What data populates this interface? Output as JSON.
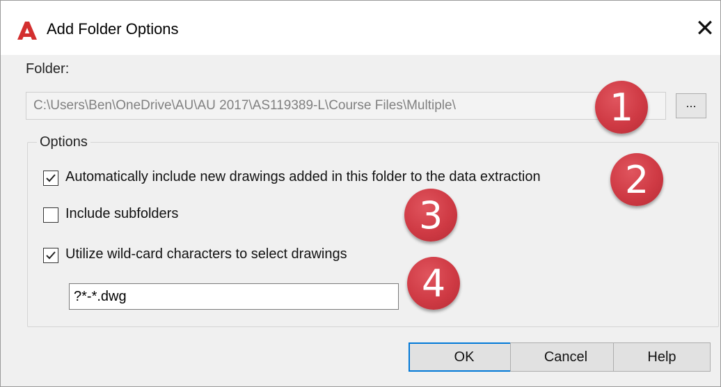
{
  "window": {
    "title": "Add Folder Options",
    "close_glyph": "✕"
  },
  "folder": {
    "label": "Folder:",
    "path": "C:\\Users\\Ben\\OneDrive\\AU\\AU 2017\\AS119389-L\\Course Files\\Multiple\\",
    "browse_label": "..."
  },
  "options": {
    "legend": "Options",
    "auto_include": {
      "label": "Automatically include new drawings added in this folder to the data extraction",
      "checked": true
    },
    "subfolders": {
      "label": "Include subfolders",
      "checked": false
    },
    "wildcard": {
      "label": "Utilize wild-card characters to select drawings",
      "checked": true
    },
    "wildcard_value": "?*-*.dwg"
  },
  "buttons": {
    "ok": "OK",
    "cancel": "Cancel",
    "help": "Help"
  },
  "annotations": [
    "1",
    "2",
    "3",
    "4"
  ],
  "colors": {
    "badge_red": "#cf3a44",
    "app_icon_red": "#d32f2f",
    "focus_blue": "#0078d7"
  },
  "icons": {
    "app": "autocad-a-icon",
    "close": "close-icon",
    "check": "checkmark-icon"
  }
}
